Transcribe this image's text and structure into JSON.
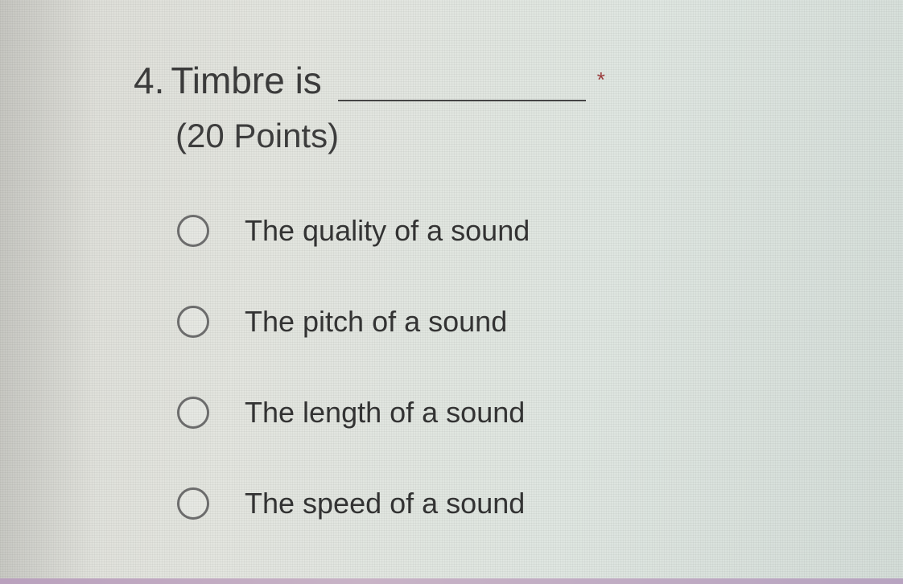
{
  "question": {
    "number": "4.",
    "text": "Timbre is",
    "required_marker": "*",
    "points": "(20 Points)"
  },
  "options": [
    {
      "label": "The quality of a sound",
      "selected": false
    },
    {
      "label": "The pitch of a sound",
      "selected": false
    },
    {
      "label": "The length of a sound",
      "selected": false
    },
    {
      "label": "The speed of a sound",
      "selected": false
    }
  ]
}
